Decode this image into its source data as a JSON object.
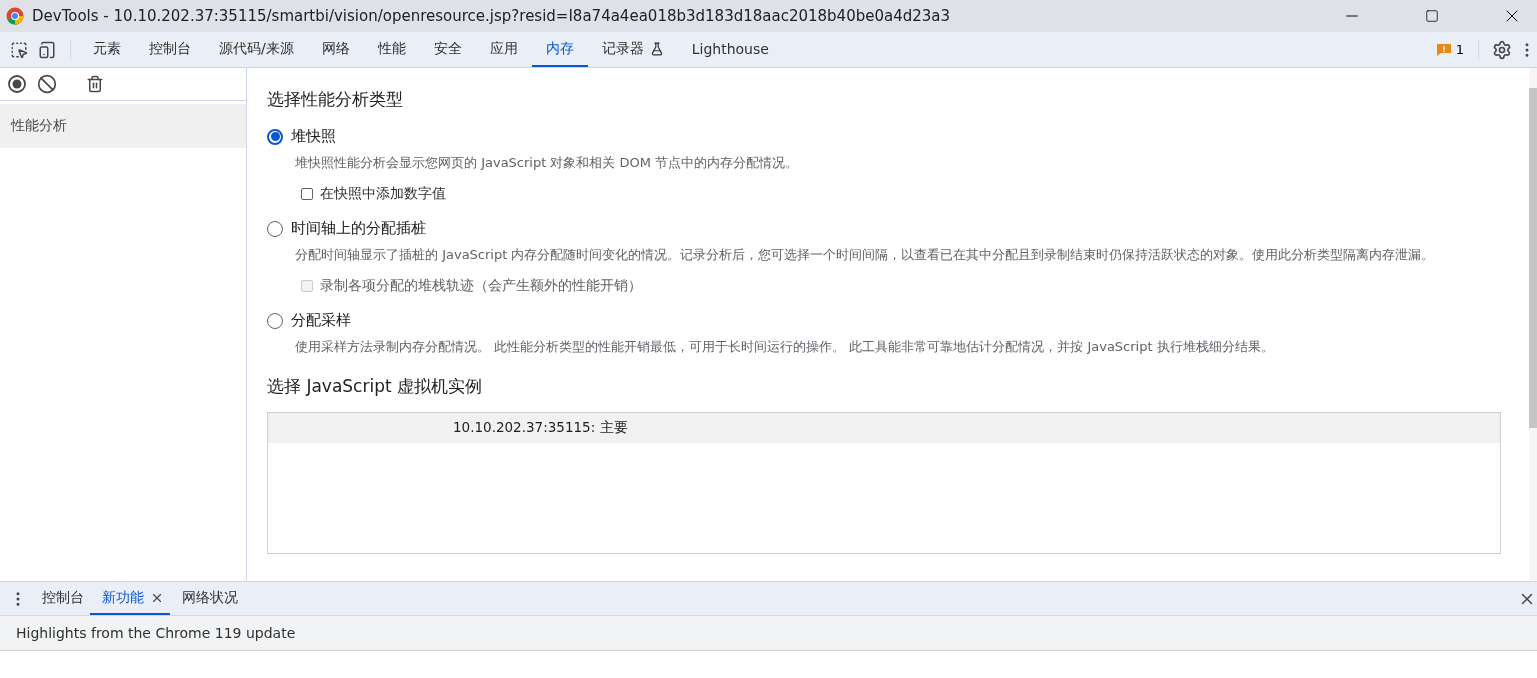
{
  "window": {
    "title": "DevTools - 10.10.202.37:35115/smartbi/vision/openresource.jsp?resid=I8a74a4ea018b3d183d18aac2018b40be0a4d23a3"
  },
  "toolbar": {
    "tabs": [
      {
        "label": "元素",
        "selected": false,
        "experimental": false
      },
      {
        "label": "控制台",
        "selected": false,
        "experimental": false
      },
      {
        "label": "源代码/来源",
        "selected": false,
        "experimental": false
      },
      {
        "label": "网络",
        "selected": false,
        "experimental": false
      },
      {
        "label": "性能",
        "selected": false,
        "experimental": false
      },
      {
        "label": "安全",
        "selected": false,
        "experimental": false
      },
      {
        "label": "应用",
        "selected": false,
        "experimental": false
      },
      {
        "label": "内存",
        "selected": true,
        "experimental": false
      },
      {
        "label": "记录器",
        "selected": false,
        "experimental": true
      },
      {
        "label": "Lighthouse",
        "selected": false,
        "experimental": false
      }
    ],
    "issues_count": "1"
  },
  "sidebar": {
    "items": [
      {
        "label": "性能分析",
        "selected": true
      }
    ]
  },
  "main": {
    "profile_heading": "选择性能分析类型",
    "profile_types": [
      {
        "label": "堆快照",
        "selected": true,
        "description": "堆快照性能分析会显示您网页的 JavaScript 对象和相关 DOM 节点中的内存分配情况。",
        "option": {
          "label": "在快照中添加数字值",
          "checked": false,
          "disabled": false
        }
      },
      {
        "label": "时间轴上的分配插桩",
        "selected": false,
        "description": "分配时间轴显示了插桩的 JavaScript 内存分配随时间变化的情况。记录分析后，您可选择一个时间间隔，以查看已在其中分配且到录制结束时仍保持活跃状态的对象。使用此分析类型隔离内存泄漏。",
        "option": {
          "label": "录制各项分配的堆栈轨迹（会产生额外的性能开销）",
          "checked": false,
          "disabled": true
        }
      },
      {
        "label": "分配采样",
        "selected": false,
        "description": "使用采样方法录制内存分配情况。 此性能分析类型的性能开销最低，可用于长时间运行的操作。 此工具能非常可靠地估计分配情况，并按 JavaScript 执行堆栈细分结果。"
      }
    ],
    "vm_heading": "选择 JavaScript 虚拟机实例",
    "vm_instances": [
      {
        "label": "10.10.202.37:35115: 主要",
        "selected": true
      }
    ]
  },
  "drawer": {
    "tabs": [
      {
        "label": "控制台",
        "selected": false,
        "closable": false
      },
      {
        "label": "新功能",
        "selected": true,
        "closable": true
      },
      {
        "label": "网络状况",
        "selected": false,
        "closable": false
      }
    ],
    "banner": "Highlights from the Chrome 119 update"
  }
}
